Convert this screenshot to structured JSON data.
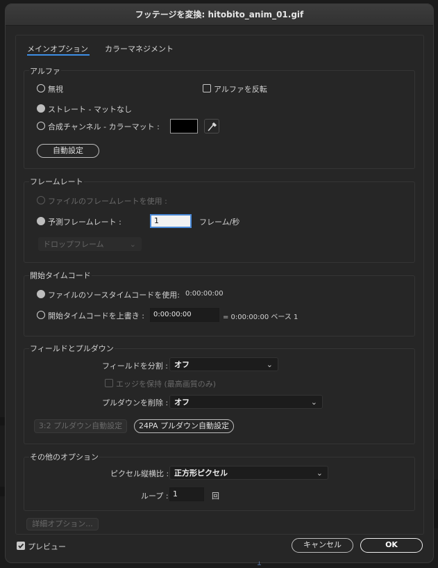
{
  "title": "フッテージを変換: hitobito_anim_01.gif",
  "tabs": [
    {
      "label": "メインオプション"
    },
    {
      "label": "カラーマネジメント"
    }
  ],
  "alpha": {
    "title": "アルファ",
    "ignore": "無視",
    "invert": "アルファを反転",
    "straight": "ストレート - マットなし",
    "premultiplied": "合成チャンネル - カラーマット :",
    "matte_color": "#000000",
    "auto_button": "自動設定"
  },
  "framerate": {
    "title": "フレームレート",
    "use_file": "ファイルのフレームレートを使用 :",
    "assume": "予測フレームレート :",
    "value": "1",
    "unit": "フレーム/秒",
    "drop_frame": "ドロップフレーム"
  },
  "timecode": {
    "title": "開始タイムコード",
    "use_source": "ファイルのソースタイムコードを使用:",
    "source_value": "0:00:00:00",
    "override": "開始タイムコードを上書き :",
    "override_value": "0:00:00:00",
    "result": "= 0:00:00:00  ベース 1"
  },
  "fields": {
    "title": "フィールドとプルダウン",
    "separate_label": "フィールドを分割 :",
    "separate_value": "オフ",
    "preserve_edges": "エッジを保持 (最高画質のみ)",
    "pulldown_label": "プルダウンを削除 :",
    "pulldown_value": "オフ",
    "guess_32": "3:2 プルダウン自動設定",
    "guess_24pa": "24PA プルダウン自動設定"
  },
  "other": {
    "title": "その他のオプション",
    "par_label": "ピクセル縦横比 :",
    "par_value": "正方形ピクセル",
    "loop_label": "ループ :",
    "loop_value": "1",
    "loop_unit": "回"
  },
  "more_options": "詳細オプション...",
  "preview": "プレビュー",
  "cancel": "キャンセル",
  "ok": "OK",
  "colors": {
    "accent": "#3d8ee6",
    "background": "#262626"
  }
}
